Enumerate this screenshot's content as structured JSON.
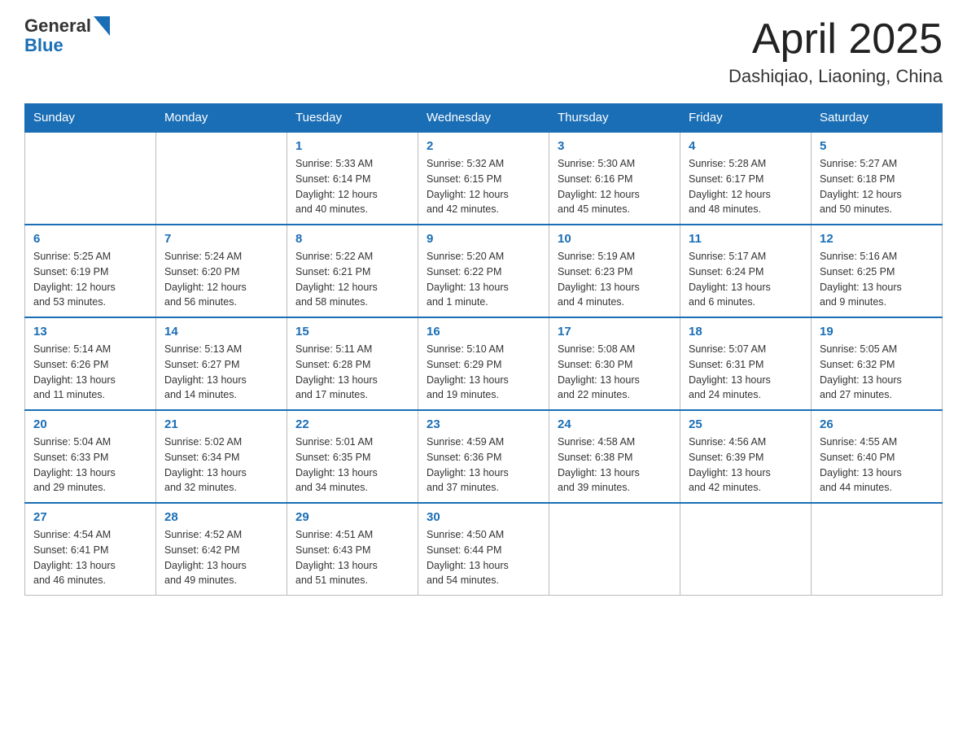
{
  "header": {
    "logo": {
      "general": "General",
      "blue": "Blue"
    },
    "title": "April 2025",
    "location": "Dashiqiao, Liaoning, China"
  },
  "weekdays": [
    "Sunday",
    "Monday",
    "Tuesday",
    "Wednesday",
    "Thursday",
    "Friday",
    "Saturday"
  ],
  "weeks": [
    [
      {
        "day": "",
        "info": ""
      },
      {
        "day": "",
        "info": ""
      },
      {
        "day": "1",
        "info": "Sunrise: 5:33 AM\nSunset: 6:14 PM\nDaylight: 12 hours\nand 40 minutes."
      },
      {
        "day": "2",
        "info": "Sunrise: 5:32 AM\nSunset: 6:15 PM\nDaylight: 12 hours\nand 42 minutes."
      },
      {
        "day": "3",
        "info": "Sunrise: 5:30 AM\nSunset: 6:16 PM\nDaylight: 12 hours\nand 45 minutes."
      },
      {
        "day": "4",
        "info": "Sunrise: 5:28 AM\nSunset: 6:17 PM\nDaylight: 12 hours\nand 48 minutes."
      },
      {
        "day": "5",
        "info": "Sunrise: 5:27 AM\nSunset: 6:18 PM\nDaylight: 12 hours\nand 50 minutes."
      }
    ],
    [
      {
        "day": "6",
        "info": "Sunrise: 5:25 AM\nSunset: 6:19 PM\nDaylight: 12 hours\nand 53 minutes."
      },
      {
        "day": "7",
        "info": "Sunrise: 5:24 AM\nSunset: 6:20 PM\nDaylight: 12 hours\nand 56 minutes."
      },
      {
        "day": "8",
        "info": "Sunrise: 5:22 AM\nSunset: 6:21 PM\nDaylight: 12 hours\nand 58 minutes."
      },
      {
        "day": "9",
        "info": "Sunrise: 5:20 AM\nSunset: 6:22 PM\nDaylight: 13 hours\nand 1 minute."
      },
      {
        "day": "10",
        "info": "Sunrise: 5:19 AM\nSunset: 6:23 PM\nDaylight: 13 hours\nand 4 minutes."
      },
      {
        "day": "11",
        "info": "Sunrise: 5:17 AM\nSunset: 6:24 PM\nDaylight: 13 hours\nand 6 minutes."
      },
      {
        "day": "12",
        "info": "Sunrise: 5:16 AM\nSunset: 6:25 PM\nDaylight: 13 hours\nand 9 minutes."
      }
    ],
    [
      {
        "day": "13",
        "info": "Sunrise: 5:14 AM\nSunset: 6:26 PM\nDaylight: 13 hours\nand 11 minutes."
      },
      {
        "day": "14",
        "info": "Sunrise: 5:13 AM\nSunset: 6:27 PM\nDaylight: 13 hours\nand 14 minutes."
      },
      {
        "day": "15",
        "info": "Sunrise: 5:11 AM\nSunset: 6:28 PM\nDaylight: 13 hours\nand 17 minutes."
      },
      {
        "day": "16",
        "info": "Sunrise: 5:10 AM\nSunset: 6:29 PM\nDaylight: 13 hours\nand 19 minutes."
      },
      {
        "day": "17",
        "info": "Sunrise: 5:08 AM\nSunset: 6:30 PM\nDaylight: 13 hours\nand 22 minutes."
      },
      {
        "day": "18",
        "info": "Sunrise: 5:07 AM\nSunset: 6:31 PM\nDaylight: 13 hours\nand 24 minutes."
      },
      {
        "day": "19",
        "info": "Sunrise: 5:05 AM\nSunset: 6:32 PM\nDaylight: 13 hours\nand 27 minutes."
      }
    ],
    [
      {
        "day": "20",
        "info": "Sunrise: 5:04 AM\nSunset: 6:33 PM\nDaylight: 13 hours\nand 29 minutes."
      },
      {
        "day": "21",
        "info": "Sunrise: 5:02 AM\nSunset: 6:34 PM\nDaylight: 13 hours\nand 32 minutes."
      },
      {
        "day": "22",
        "info": "Sunrise: 5:01 AM\nSunset: 6:35 PM\nDaylight: 13 hours\nand 34 minutes."
      },
      {
        "day": "23",
        "info": "Sunrise: 4:59 AM\nSunset: 6:36 PM\nDaylight: 13 hours\nand 37 minutes."
      },
      {
        "day": "24",
        "info": "Sunrise: 4:58 AM\nSunset: 6:38 PM\nDaylight: 13 hours\nand 39 minutes."
      },
      {
        "day": "25",
        "info": "Sunrise: 4:56 AM\nSunset: 6:39 PM\nDaylight: 13 hours\nand 42 minutes."
      },
      {
        "day": "26",
        "info": "Sunrise: 4:55 AM\nSunset: 6:40 PM\nDaylight: 13 hours\nand 44 minutes."
      }
    ],
    [
      {
        "day": "27",
        "info": "Sunrise: 4:54 AM\nSunset: 6:41 PM\nDaylight: 13 hours\nand 46 minutes."
      },
      {
        "day": "28",
        "info": "Sunrise: 4:52 AM\nSunset: 6:42 PM\nDaylight: 13 hours\nand 49 minutes."
      },
      {
        "day": "29",
        "info": "Sunrise: 4:51 AM\nSunset: 6:43 PM\nDaylight: 13 hours\nand 51 minutes."
      },
      {
        "day": "30",
        "info": "Sunrise: 4:50 AM\nSunset: 6:44 PM\nDaylight: 13 hours\nand 54 minutes."
      },
      {
        "day": "",
        "info": ""
      },
      {
        "day": "",
        "info": ""
      },
      {
        "day": "",
        "info": ""
      }
    ]
  ]
}
